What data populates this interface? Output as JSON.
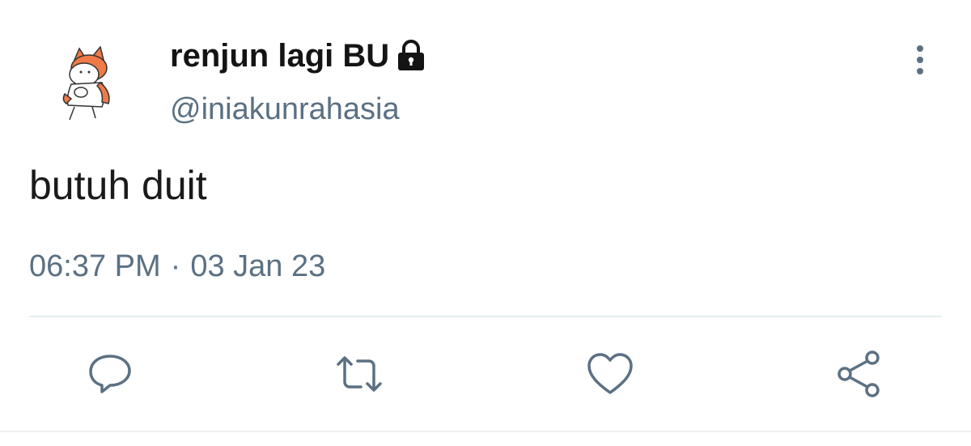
{
  "user": {
    "display_name": "renjun lagi BU",
    "handle": "@iniakunrahasia",
    "protected_icon": "lock-icon",
    "avatar": "fox-cartoon-avatar"
  },
  "tweet": {
    "text": "butuh duit",
    "time": "06:37 PM",
    "separator": "·",
    "date": "03 Jan 23"
  },
  "actions": {
    "reply": "reply-icon",
    "retweet": "retweet-icon",
    "like": "heart-icon",
    "share": "share-icon"
  },
  "colors": {
    "name": "#141414",
    "secondary": "#5b7083",
    "body_text": "#1a1a1a",
    "avatar_accent": "#ee7a47",
    "divider": "#e6ecf0"
  }
}
